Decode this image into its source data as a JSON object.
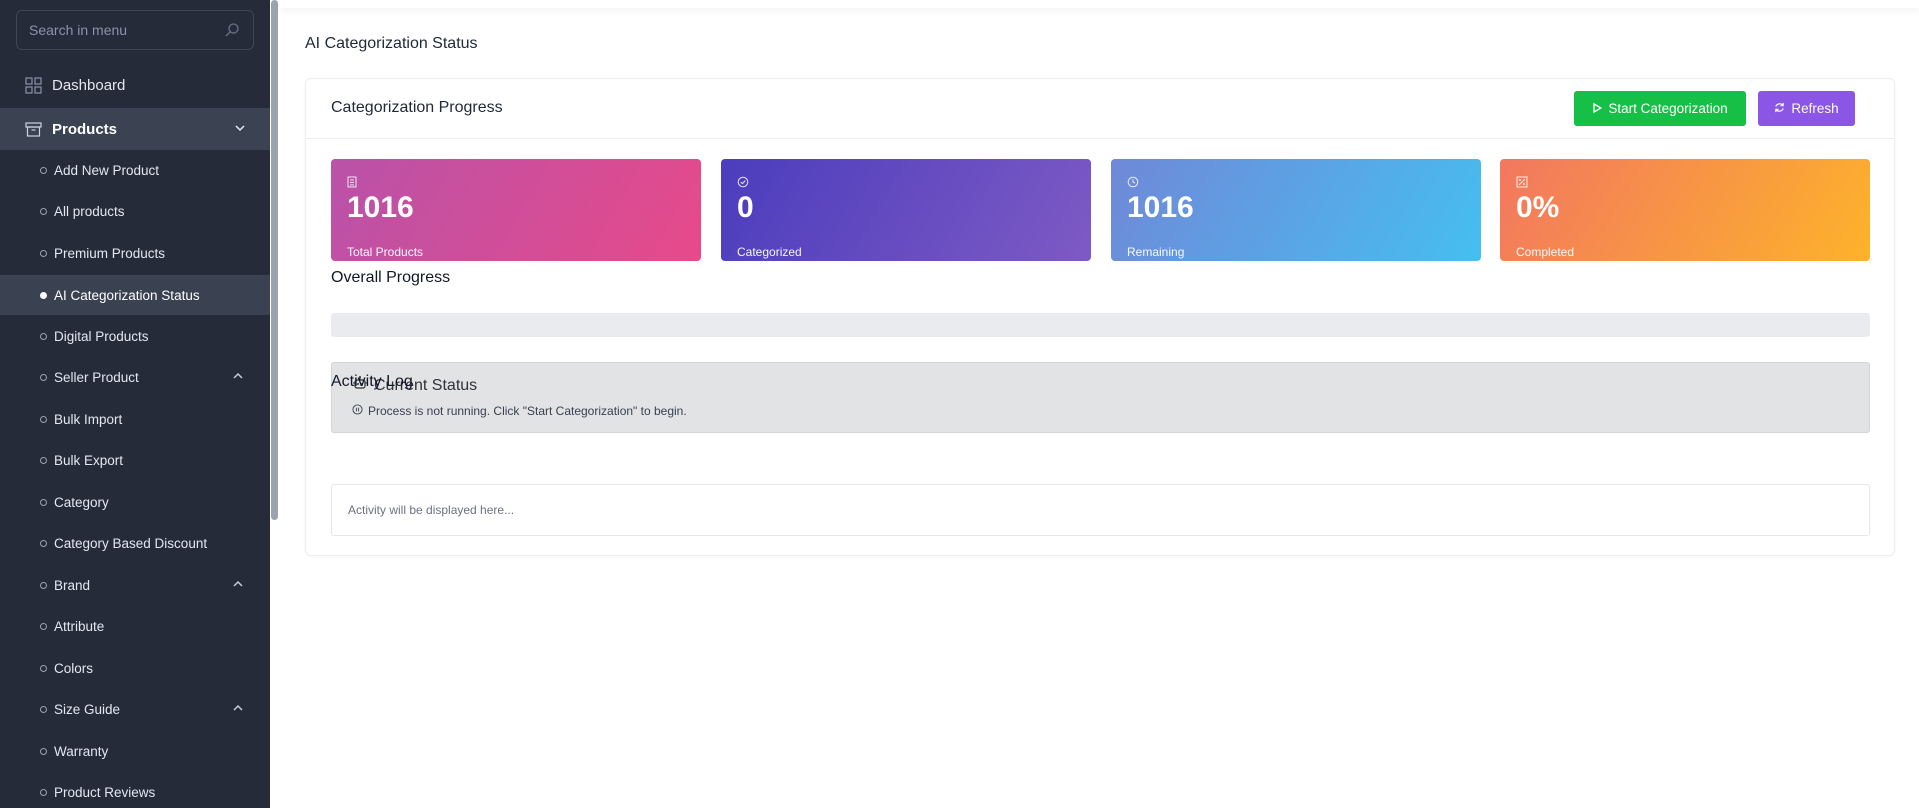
{
  "sidebar": {
    "search_placeholder": "Search in menu",
    "dashboard_label": "Dashboard",
    "products_label": "Products",
    "items": [
      {
        "label": "Add New Product"
      },
      {
        "label": "All products"
      },
      {
        "label": "Premium Products"
      },
      {
        "label": "AI Categorization Status"
      },
      {
        "label": "Digital Products"
      },
      {
        "label": "Seller Product"
      },
      {
        "label": "Bulk Import"
      },
      {
        "label": "Bulk Export"
      },
      {
        "label": "Category"
      },
      {
        "label": "Category Based Discount"
      },
      {
        "label": "Brand"
      },
      {
        "label": "Attribute"
      },
      {
        "label": "Colors"
      },
      {
        "label": "Size Guide"
      },
      {
        "label": "Warranty"
      },
      {
        "label": "Product Reviews"
      }
    ]
  },
  "page": {
    "title": "AI Categorization Status"
  },
  "card": {
    "title": "Categorization Progress",
    "start_label": "Start Categorization",
    "refresh_label": "Refresh"
  },
  "stats": [
    {
      "value": "1016",
      "label": "Total Products",
      "icon": "list-icon"
    },
    {
      "value": "0",
      "label": "Categorized",
      "icon": "check-circle-icon"
    },
    {
      "value": "1016",
      "label": "Remaining",
      "icon": "clock-icon"
    },
    {
      "value": "0%",
      "label": "Completed",
      "icon": "percent-icon"
    }
  ],
  "progress": {
    "title": "Overall Progress",
    "fraction": 0
  },
  "status": {
    "title": "Current Status",
    "message": "Process is not running. Click \"Start Categorization\" to begin."
  },
  "log": {
    "title": "Activity Log",
    "placeholder": "Activity will be displayed here..."
  },
  "colors": {
    "sidebar_bg": "#262b3a",
    "success": "#16c047",
    "purple": "#8b55e6"
  }
}
